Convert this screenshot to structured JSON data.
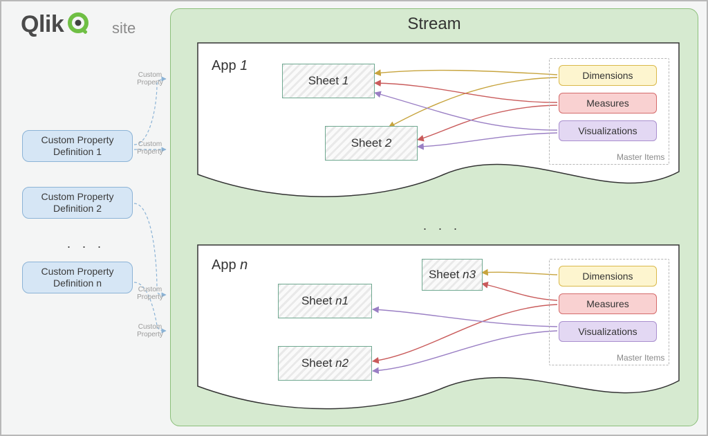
{
  "brand": {
    "name": "Qlik"
  },
  "site_label": "site",
  "stream": {
    "title": "Stream"
  },
  "custom_properties": {
    "items": [
      {
        "label": "Custom Property Definition 1"
      },
      {
        "label": "Custom Property Definition 2"
      },
      {
        "label": "Custom Property Definition n"
      }
    ],
    "ellipsis": ". . ."
  },
  "cp_tag": "Custom Property",
  "apps": {
    "ellipsis": ". . .",
    "items": [
      {
        "label_prefix": "App ",
        "label_suffix": "1",
        "sheets": [
          {
            "label_prefix": "Sheet ",
            "label_suffix": "1"
          },
          {
            "label_prefix": "Sheet ",
            "label_suffix": "2"
          }
        ],
        "master_items": {
          "title": "Master Items",
          "dimensions": "Dimensions",
          "measures": "Measures",
          "visualizations": "Visualizations"
        }
      },
      {
        "label_prefix": "App ",
        "label_suffix": "n",
        "sheets": [
          {
            "label_prefix": "Sheet ",
            "label_suffix": "n1"
          },
          {
            "label_prefix": "Sheet ",
            "label_suffix": "n2"
          },
          {
            "label_prefix": "Sheet ",
            "label_suffix": "n3"
          }
        ],
        "master_items": {
          "title": "Master Items",
          "dimensions": "Dimensions",
          "measures": "Measures",
          "visualizations": "Visualizations"
        }
      }
    ]
  },
  "colors": {
    "stream_bg": "#d6ead0",
    "cp_bg": "#d6e6f5",
    "dim": "#d9b84a",
    "meas": "#d46a6a",
    "viz": "#a98fce",
    "dash": "#8bb3d6"
  }
}
